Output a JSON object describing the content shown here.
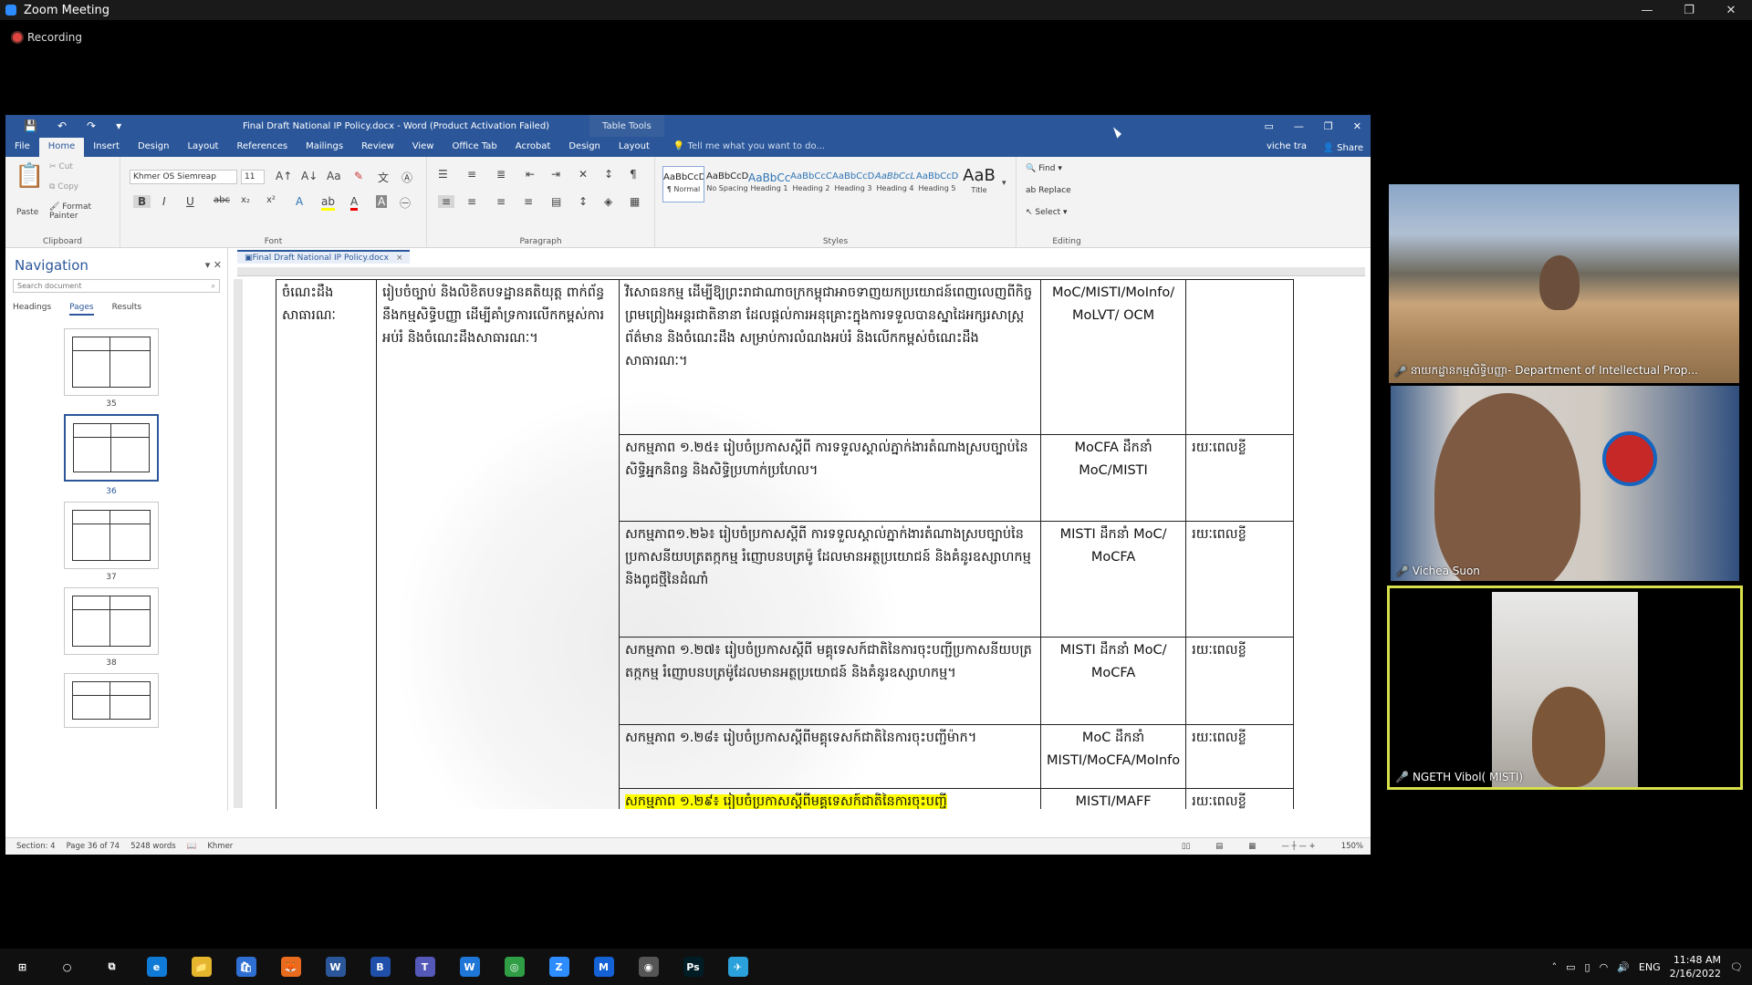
{
  "zoom": {
    "title": "Zoom Meeting",
    "recording": "Recording",
    "window_buttons": [
      "—",
      "❐",
      "✕"
    ]
  },
  "word": {
    "title": "Final Draft National IP Policy.docx - Word (Product Activation Failed)",
    "table_tools": "Table Tools",
    "tabs": [
      "File",
      "Home",
      "Insert",
      "Design",
      "Layout",
      "References",
      "Mailings",
      "Review",
      "View",
      "Office Tab",
      "Acrobat",
      "Design",
      "Layout"
    ],
    "tell_me": "Tell me what you want to do...",
    "user": "viche tra",
    "share": "Share",
    "clipboard": {
      "paste": "Paste",
      "cut": "Cut",
      "copy": "Copy",
      "format_painter": "Format Painter",
      "label": "Clipboard"
    },
    "font": {
      "name": "Khmer OS Siemreap",
      "size": "11",
      "label": "Font"
    },
    "paragraph_label": "Paragraph",
    "styles": [
      {
        "sample": "AaBbCcDc",
        "name": "¶ Normal"
      },
      {
        "sample": "AaBbCcDc",
        "name": "No Spacing"
      },
      {
        "sample": "AaBbCc",
        "name": "Heading 1"
      },
      {
        "sample": "AaBbCcC",
        "name": "Heading 2"
      },
      {
        "sample": "AaBbCcD",
        "name": "Heading 3"
      },
      {
        "sample": "AaBbCcL",
        "name": "Heading 4"
      },
      {
        "sample": "AaBbCcDc",
        "name": "Heading 5"
      },
      {
        "sample": "AaB",
        "name": "Title"
      }
    ],
    "styles_label": "Styles",
    "editing": {
      "find": "Find",
      "replace": "Replace",
      "select": "Select",
      "label": "Editing"
    },
    "nav": {
      "title": "Navigation",
      "search_placeholder": "Search document",
      "tabs": [
        "Headings",
        "Pages",
        "Results"
      ],
      "pages": [
        "35",
        "36",
        "37",
        "38"
      ]
    },
    "doc_tab": "Final Draft National IP Policy.docx",
    "table": {
      "col1": "ចំណេះដឹងសាធារណៈ",
      "col2": "រៀបចំច្បាប់ និងលិខិតបទដ្ឋានគតិយុត្ត ពាក់ព័ន្ធនឹងកម្មសិទ្ធិបញ្ញា ដើម្បីគាំទ្រការលើកកម្ពស់ការអប់រំ និងចំណេះដឹងសាធារណៈ។",
      "rows": [
        {
          "text": "វិសោធនកម្ម ដើម្បីឱ្យព្រះរាជាណាចក្រកម្ពុជាអាចទាញយកប្រយោជន៍ពេញលេញពីកិច្ចព្រមព្រៀងអន្តរជាតិនានា ដែលផ្តល់ការអនុគ្រោះក្នុងការទទួលបានស្នាដៃអក្សរសាស្ត្រ ព័ត៌មាន និងចំណេះដឹង សម្រាប់ការលំណងអប់រំ និងលើកកម្ពស់ចំណេះដឹងសាធារណៈ។",
          "lead": "MoC/MISTI/MoInfo/ MoLVT/ OCM",
          "time": ""
        },
        {
          "text": "សកម្មភាព ១.២៥៖ រៀបចំប្រកាសស្តីពី ការទទួលស្គាល់ភ្នាក់ងារតំណាងស្របច្បាប់នៃសិទ្ធិអ្នកនិពន្ធ និងសិទ្ធិប្រហាក់ប្រហែល។",
          "lead": "MoCFA ដឹកនាំ MoC/MISTI",
          "time": "រយៈពេលខ្លី"
        },
        {
          "text": "សកម្មភាព១.២៦៖ រៀបចំប្រកាសស្តីពី ការទទួលស្គាល់ភ្នាក់ងារតំណាងស្របច្បាប់នៃប្រកាសនីយបត្រតក្កកម្ម រំញោបនបត្រម៉ូ ដែលមានអត្ថប្រយោជន៍ និងគំនូរឧស្សាហកម្ម និងពូជថ្មីនៃដំណាំ",
          "lead": "MISTI ដឹកនាំ MoC/ MoCFA",
          "time": "រយៈពេលខ្លី"
        },
        {
          "text": "សកម្មភាព ១.២៧៖ រៀបចំប្រកាសស្តីពី មគ្គុទេសក៍ជាតិនៃការចុះបញ្ជីប្រកាសនីយបត្រតក្កកម្ម រំញោបនបត្រម៉ូដែលមានអត្ថប្រយោជន៍ និងគំនូរឧស្សាហកម្ម។",
          "lead": "MISTI ដឹកនាំ MoC/ MoCFA",
          "time": "រយៈពេលខ្លី"
        },
        {
          "text": "សកម្មភាព ១.២៨៖ រៀបចំប្រកាសស្តីពីមគ្គុទេសក៍ជាតិនៃការចុះបញ្ជីម៉ាក។",
          "lead": "MoC ដឹកនាំ MISTI/MoCFA/MoInfo",
          "time": "រយៈពេលខ្លី"
        },
        {
          "text": "សកម្មភាព ១.២៩៖ រៀបចំប្រកាសស្តីពីមគ្គុទេសក៍ជាតិនៃការចុះបញ្ជី",
          "lead": "MISTI/MAFF",
          "time": "រយៈពេលខ្លី"
        }
      ]
    },
    "status": {
      "section": "Section: 4",
      "page": "Page 36 of 74",
      "words": "5248 words",
      "lang": "Khmer",
      "zoom": "150%"
    }
  },
  "participants": [
    {
      "name": "នាយកដ្ឋានកម្មសិទ្ធិបញ្ញា- Department of Intellectual Prop...",
      "muted": true
    },
    {
      "name": "Vichea Suon",
      "muted": true
    },
    {
      "name": "NGETH Vibol( MISTI)",
      "muted": false
    }
  ],
  "taskbar": {
    "apps": [
      "⊞",
      "○",
      "⧉",
      "e",
      "📁",
      "🛍",
      "🦊",
      "W",
      "B",
      "T",
      "W",
      "◎",
      "Z",
      "M",
      "◉",
      "Ps",
      "✈"
    ],
    "app_colors": [
      "#101010",
      "#101010",
      "#101010",
      "#0f7bd6",
      "#e6b52e",
      "#2f6fd3",
      "#e86b1e",
      "#2b579a",
      "#1f4fa8",
      "#5458b7",
      "#1e76d6",
      "#2f9e44",
      "#2d8cff",
      "#1462d6",
      "#555555",
      "#001d26",
      "#2aa1da"
    ],
    "lang": "ENG",
    "time": "11:48 AM",
    "date": "2/16/2022"
  }
}
